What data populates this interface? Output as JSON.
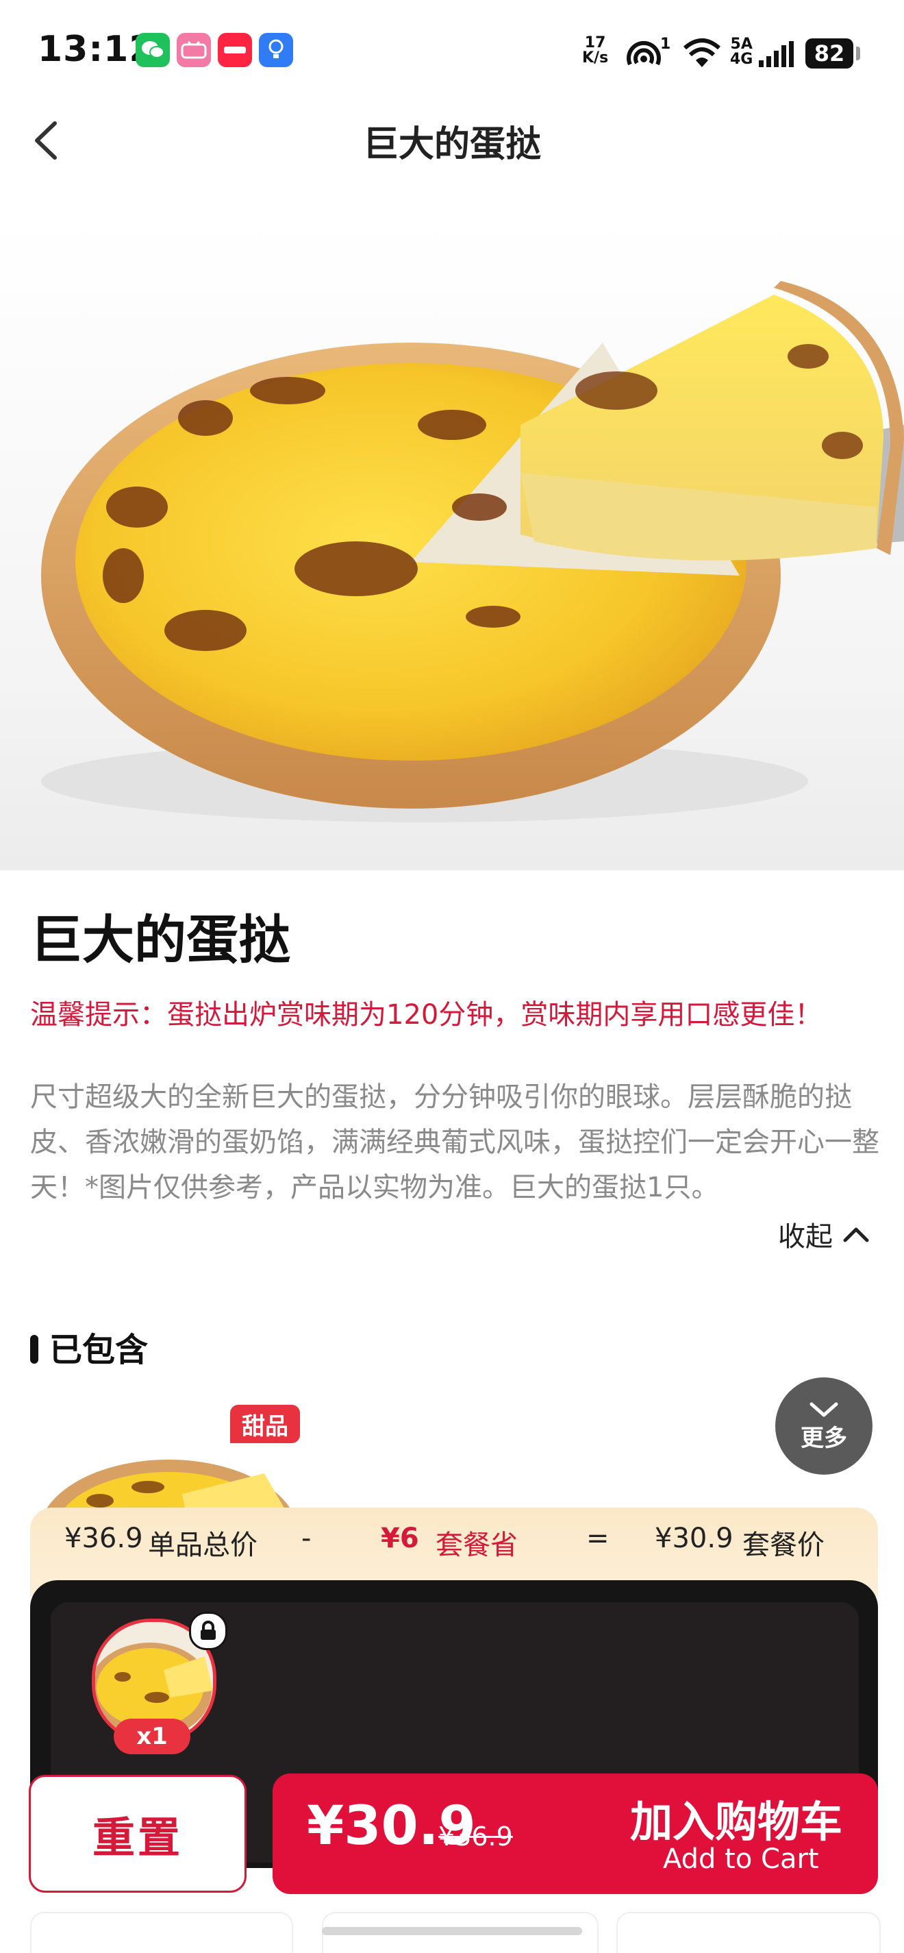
{
  "status_bar": {
    "time": "13:12",
    "apps": [
      "wechat-icon",
      "bilibili-icon",
      "xiaohongshu-icon",
      "tips-icon"
    ],
    "net_speed_top": "17",
    "net_speed_bottom": "K/s",
    "hotspot_count": "1",
    "signal_top": "5A",
    "signal_bottom": "4G",
    "battery": "82"
  },
  "nav": {
    "title": "巨大的蛋挞"
  },
  "product": {
    "name": "巨大的蛋挞",
    "tip": "温馨提示：蛋挞出炉赏味期为120分钟，赏味期内享用口感更佳！",
    "description": "尺寸超级大的全新巨大的蛋挞，分分钟吸引你的眼球。层层酥脆的挞皮、香浓嫩滑的蛋奶馅，满满经典葡式风味，蛋挞控们一定会开心一整天！*图片仅供参考，产品以实物为准。巨大的蛋挞1只。",
    "collapse_label": "收起"
  },
  "included": {
    "title": "已包含",
    "badge": "甜品",
    "more_label": "更多"
  },
  "summary": {
    "single_total_price": "¥36.9",
    "single_total_label": "单品总价",
    "minus": "-",
    "saved_amount": "¥6",
    "saved_label": "套餐省",
    "equals": "=",
    "combo_price": "¥30.9",
    "combo_label": "套餐价"
  },
  "selected_item": {
    "quantity": "x1"
  },
  "actions": {
    "reset_label": "重置",
    "price": "¥30.9",
    "original_price": "¥36.9",
    "add_cart_cn": "加入购物车",
    "add_cart_en": "Add to Cart"
  },
  "colors": {
    "accent_red": "#e0103a",
    "tip_red": "#d4193b",
    "summary_bg": "#fbe8c7",
    "panel_dark": "#151515"
  }
}
